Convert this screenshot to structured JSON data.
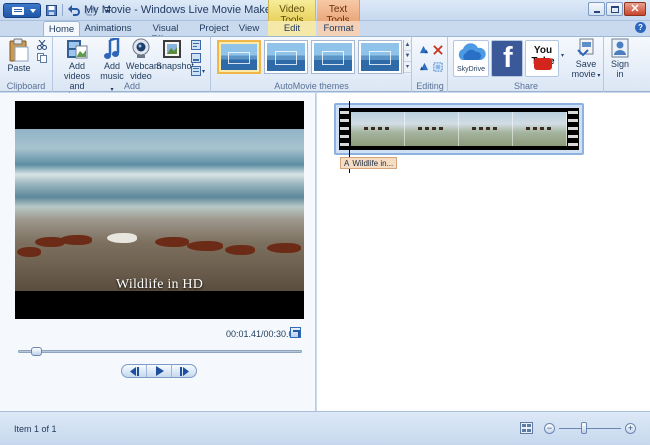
{
  "window": {
    "title": "My Movie - Windows Live Movie Maker",
    "context_tabs": {
      "video_tools": "Video Tools",
      "text_tools": "Text Tools"
    }
  },
  "tabs": [
    "Home",
    "Animations",
    "Visual Effects",
    "Project",
    "View",
    "Edit",
    "Format"
  ],
  "active_tab": "Home",
  "ribbon": {
    "clipboard": {
      "label": "Clipboard",
      "paste": "Paste"
    },
    "add": {
      "label": "Add",
      "add_videos_line1": "Add videos",
      "add_videos_line2": "and photos",
      "add_music_line1": "Add",
      "add_music_line2": "music",
      "webcam_line1": "Webcam",
      "webcam_line2": "video",
      "snapshot": "Snapshot"
    },
    "automovie": {
      "label": "AutoMovie themes"
    },
    "editing": {
      "label": "Editing"
    },
    "share": {
      "label": "Share",
      "skydrive": "SkyDrive",
      "youtube": "You Tube",
      "save_line1": "Save",
      "save_line2": "movie",
      "signin_line1": "Sign",
      "signin_line2": "in"
    }
  },
  "preview": {
    "caption": "Wildlife in HD",
    "timecode": "00:01.41/00:30.09",
    "progress_fraction": 0.047
  },
  "storyboard": {
    "clip_caption_prefix": "A",
    "clip_caption": "Wildlife in..."
  },
  "status": {
    "text": "Item 1 of 1",
    "zoom_fraction": 0.4
  },
  "colors": {
    "accent": "#2b67c0",
    "video_tools": "#e8d25f",
    "text_tools": "#eaa77a",
    "selection": "#f0b64a"
  }
}
